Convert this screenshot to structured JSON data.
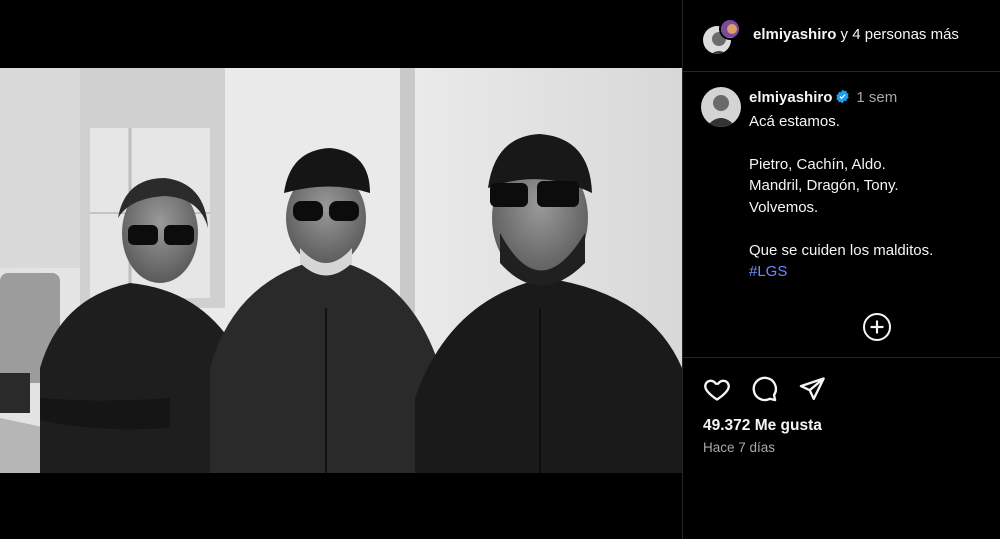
{
  "header": {
    "username": "elmiyashiro",
    "others_text": "y 4 personas más"
  },
  "caption": {
    "username": "elmiyashiro",
    "time": "1 sem",
    "lines": [
      "Acá estamos.",
      "",
      "Pietro, Cachín, Aldo.",
      "Mandril, Dragón, Tony.",
      "Volvemos.",
      "",
      "Que se cuiden los malditos."
    ],
    "hashtag": "#LGS"
  },
  "stats": {
    "likes": "49.372 Me gusta",
    "date": "Hace 7 días"
  },
  "icons": {
    "like": "heart-icon",
    "comment": "comment-bubble-icon",
    "share": "paper-plane-icon",
    "add": "plus-circle-icon",
    "verified": "verified-badge-icon"
  },
  "colors": {
    "background": "#000000",
    "divider": "#262626",
    "text": "#f5f5f5",
    "muted": "#a8a8a8",
    "hashtag": "#6b8cff",
    "verified": "#1d9bf0"
  }
}
